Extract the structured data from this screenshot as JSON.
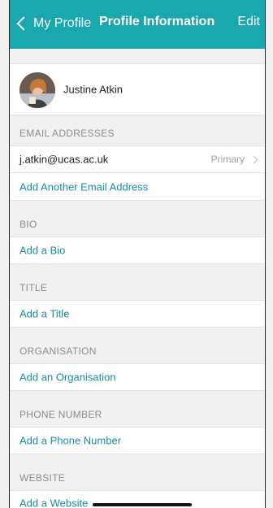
{
  "nav": {
    "back_label": "My Profile",
    "title": "Profile Information",
    "edit_label": "Edit",
    "color": "#1aa7ae"
  },
  "profile": {
    "name": "Justine Atkin"
  },
  "email": {
    "header": "EMAIL ADDRESSES",
    "address": "j.atkin@ucas.ac.uk",
    "badge": "Primary",
    "add_label": "Add Another Email Address"
  },
  "bio": {
    "header": "BIO",
    "add_label": "Add a Bio"
  },
  "title_section": {
    "header": "TITLE",
    "add_label": "Add a Title"
  },
  "organisation": {
    "header": "ORGANISATION",
    "add_label": "Add an Organisation"
  },
  "phone": {
    "header": "PHONE NUMBER",
    "add_label": "Add a Phone Number"
  },
  "website": {
    "header": "WEBSITE",
    "add_label": "Add a Website"
  },
  "colors": {
    "link": "#1a8e9e",
    "header_text": "#8c8c8c",
    "background": "#f1f1f1"
  }
}
